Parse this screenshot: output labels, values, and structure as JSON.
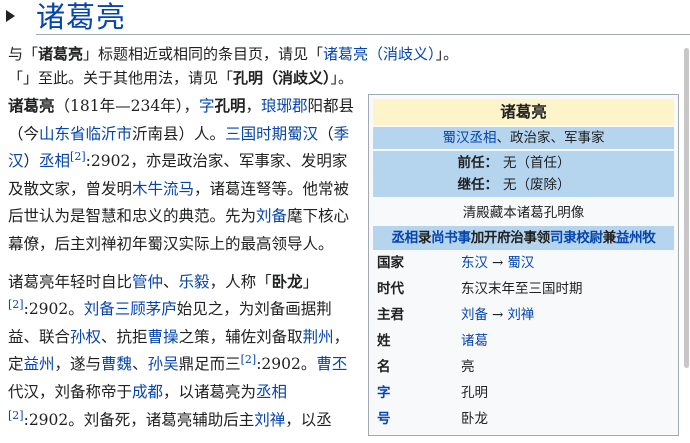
{
  "header": {
    "title": "诸葛亮"
  },
  "hatnote": {
    "line1": {
      "pre": "与「",
      "term": "诸葛亮",
      "mid": "」标题相近或相同的条目页，请见「",
      "link": "诸葛亮（消歧义）",
      "post": "」。"
    },
    "line2": {
      "pre": "「",
      "mid1": "」至此。关于其他用法，请见「",
      "term": "孔明（消歧义）",
      "post": "」。"
    }
  },
  "lead": {
    "p1": [
      {
        "t": "诸葛亮",
        "k": "b"
      },
      {
        "t": "（181年—234年）",
        "k": "t"
      },
      {
        "t": "，",
        "k": "t"
      },
      {
        "t": "字",
        "k": "a"
      },
      {
        "t": "孔明",
        "k": "b"
      },
      {
        "t": "，",
        "k": "t"
      },
      {
        "t": "琅琊郡",
        "k": "a"
      },
      {
        "t": "阳都县（今",
        "k": "t"
      },
      {
        "t": "山东省",
        "k": "a"
      },
      {
        "t": "临沂市",
        "k": "a"
      },
      {
        "t": "沂南县）人。",
        "k": "t"
      },
      {
        "t": "三国时期",
        "k": "a"
      },
      {
        "t": "蜀汉",
        "k": "a"
      },
      {
        "t": "（",
        "k": "t"
      },
      {
        "t": "季汉",
        "k": "a"
      },
      {
        "t": "）",
        "k": "t"
      },
      {
        "t": "丞相",
        "k": "a"
      },
      {
        "t": "[2]",
        "k": "s"
      },
      {
        "t": ":2902",
        "k": "t"
      },
      {
        "t": "，亦是政治家、军事家、发明家及散文家，曾发明",
        "k": "t"
      },
      {
        "t": "木牛流马",
        "k": "a"
      },
      {
        "t": "，诸葛连弩等。他常被后世认为是智慧和忠义的典范。先为",
        "k": "t"
      },
      {
        "t": "刘备",
        "k": "a"
      },
      {
        "t": "麾下核心幕僚，后主刘禅初年蜀汉实际上的最高领导人。",
        "k": "t"
      }
    ],
    "p2": [
      {
        "t": "诸葛亮年轻时自比",
        "k": "t"
      },
      {
        "t": "管仲",
        "k": "a"
      },
      {
        "t": "、",
        "k": "t"
      },
      {
        "t": "乐毅",
        "k": "a"
      },
      {
        "t": "，人称「",
        "k": "t"
      },
      {
        "t": "卧龙",
        "k": "b"
      },
      {
        "t": "」",
        "k": "t"
      },
      {
        "t": "[2]",
        "k": "s"
      },
      {
        "t": ":2902。",
        "k": "t"
      },
      {
        "t": "刘备",
        "k": "a"
      },
      {
        "t": "三顾茅庐",
        "k": "a"
      },
      {
        "t": "始见之，为刘备画据荆益、联合",
        "k": "t"
      },
      {
        "t": "孙权",
        "k": "a"
      },
      {
        "t": "、抗拒",
        "k": "t"
      },
      {
        "t": "曹操",
        "k": "a"
      },
      {
        "t": "之策，辅佐刘备取",
        "k": "t"
      },
      {
        "t": "荆州",
        "k": "a"
      },
      {
        "t": "，定",
        "k": "t"
      },
      {
        "t": "益州",
        "k": "a"
      },
      {
        "t": "，遂与",
        "k": "t"
      },
      {
        "t": "曹魏",
        "k": "a"
      },
      {
        "t": "、",
        "k": "t"
      },
      {
        "t": "孙吴",
        "k": "a"
      },
      {
        "t": "鼎足而三",
        "k": "t"
      },
      {
        "t": "[2]",
        "k": "s"
      },
      {
        "t": ":2902。",
        "k": "t"
      },
      {
        "t": "曹丕",
        "k": "a"
      },
      {
        "t": "代汉，刘备称帝于",
        "k": "t"
      },
      {
        "t": "成都",
        "k": "a"
      },
      {
        "t": "，以诸葛亮为",
        "k": "t"
      },
      {
        "t": "丞相",
        "k": "a"
      },
      {
        "t": "[2]",
        "k": "s"
      },
      {
        "t": ":2902。刘备死，诸葛亮辅助后主",
        "k": "t"
      },
      {
        "t": "刘禅",
        "k": "a"
      },
      {
        "t": "，以丞",
        "k": "t"
      }
    ]
  },
  "infobox": {
    "title": "诸葛亮",
    "roles_link": "蜀汉丞相",
    "roles_rest": "、政治家、军事家",
    "terms": [
      {
        "label": "前任：",
        "value": "无（首任）"
      },
      {
        "label": "继任：",
        "value": "无（废除）"
      }
    ],
    "caption": "清殿藏本诸葛孔明像",
    "office": [
      {
        "t": "丞相",
        "k": "a"
      },
      {
        "t": "录",
        "k": "b"
      },
      {
        "t": "尚书事",
        "k": "a"
      },
      {
        "t": "加开府治事领",
        "k": "b"
      },
      {
        "t": "司隶校尉",
        "k": "a"
      },
      {
        "t": "兼",
        "k": "b"
      },
      {
        "t": "益州牧",
        "k": "a"
      }
    ],
    "rows": [
      {
        "label": "国家",
        "label_link": false,
        "values": [
          "东汉",
          "蜀汉"
        ],
        "arrow": "→"
      },
      {
        "label": "时代",
        "label_link": false,
        "values": [
          "东汉末年至三国时期"
        ],
        "plain": true
      },
      {
        "label": "主君",
        "label_link": false,
        "values": [
          "刘备",
          "刘禅"
        ],
        "arrow": "→"
      },
      {
        "label": "姓",
        "label_link": false,
        "values": [
          "诸葛"
        ]
      },
      {
        "label": "名",
        "label_link": false,
        "values": [
          "亮"
        ],
        "plain": true
      },
      {
        "label": "字",
        "label_link": true,
        "values": [
          "孔明"
        ],
        "plain": true
      },
      {
        "label": "号",
        "label_link": true,
        "values": [
          "卧龙"
        ],
        "plain": true
      }
    ]
  }
}
